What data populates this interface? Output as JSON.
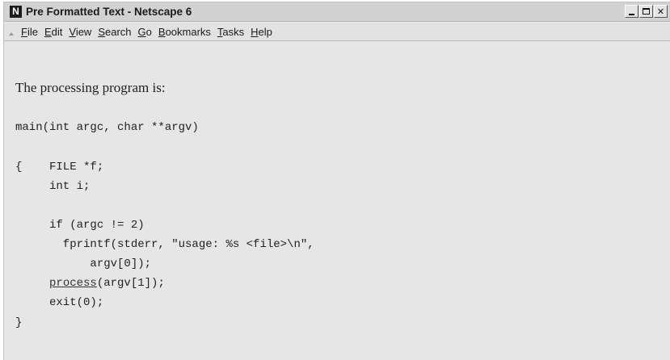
{
  "window": {
    "title": "Pre Formatted Text - Netscape 6",
    "app_icon": "N",
    "controls": {
      "minimize": "minimize-icon",
      "maximize": "maximize-icon",
      "close": "✕"
    }
  },
  "menubar": {
    "items": [
      {
        "acc": "F",
        "rest": "ile"
      },
      {
        "acc": "E",
        "rest": "dit"
      },
      {
        "acc": "V",
        "rest": "iew"
      },
      {
        "acc": "S",
        "rest": "earch"
      },
      {
        "acc": "G",
        "rest": "o"
      },
      {
        "acc": "B",
        "rest": "ookmarks"
      },
      {
        "acc": "T",
        "rest": "asks"
      },
      {
        "acc": "H",
        "rest": "elp"
      }
    ]
  },
  "content": {
    "intro": "The processing program is:",
    "code": {
      "line1": "main(int argc, char **argv)",
      "line2": "{    FILE *f;",
      "line3": "     int i;",
      "line4": "     if (argc != 2)",
      "line5": "       fprintf(stderr, \"usage: %s <file>\\n\",",
      "line6": "           argv[0]);",
      "line7_indent": "     ",
      "line7_link": "process",
      "line7_rest": "(argv[1]);",
      "line8": "     exit(0);",
      "line9": "}"
    }
  }
}
